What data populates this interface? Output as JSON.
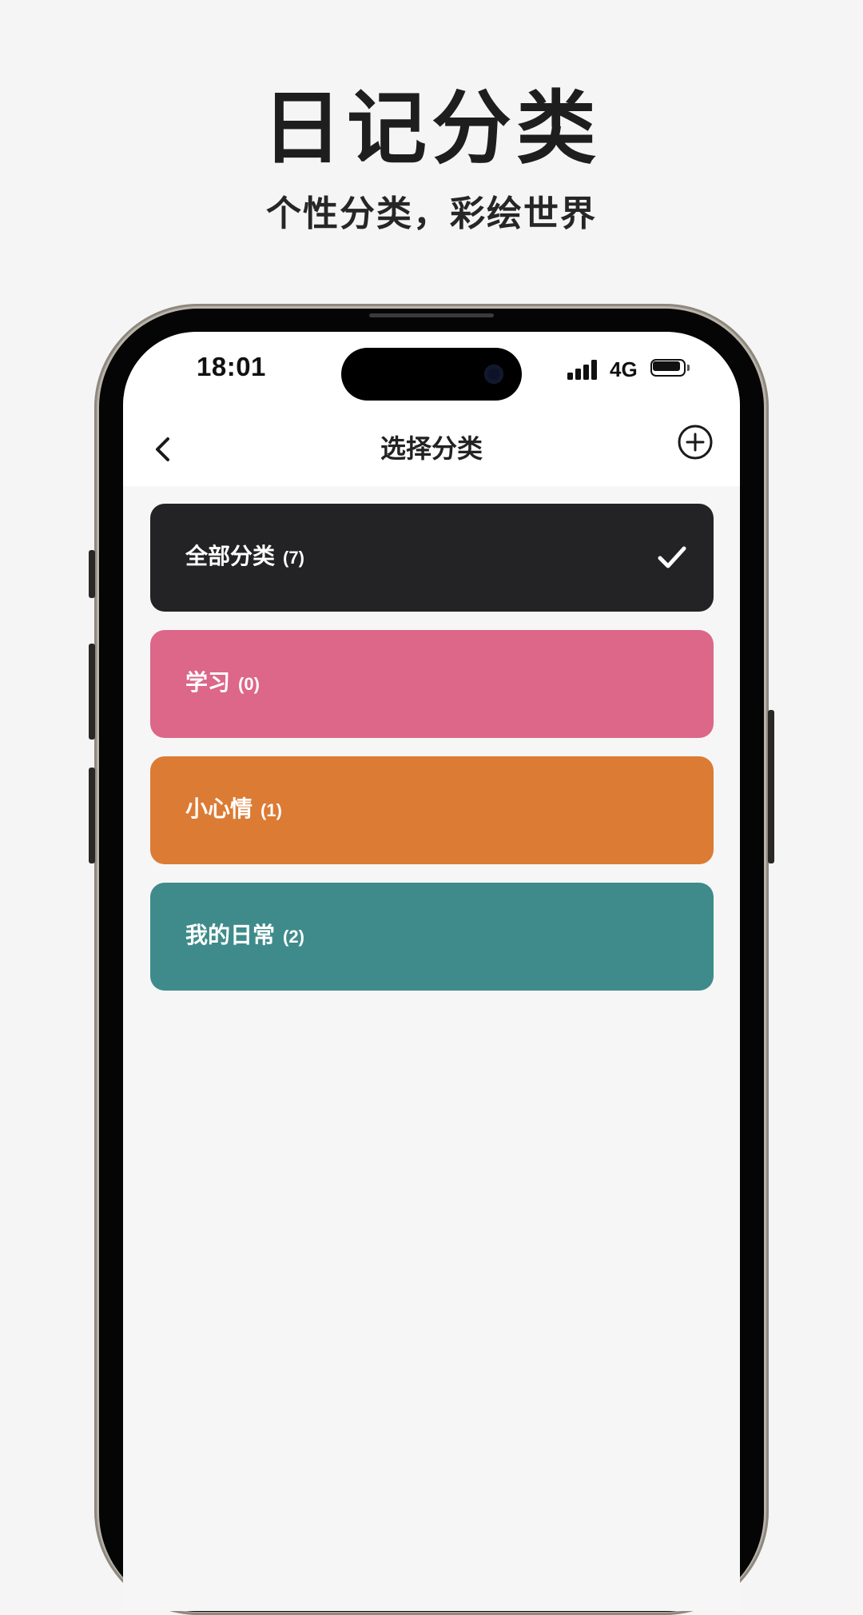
{
  "promo": {
    "title": "日记分类",
    "subtitle": "个性分类，彩绘世界"
  },
  "status_bar": {
    "time": "18:01",
    "network": "4G",
    "icons": [
      "signal-icon",
      "battery-icon"
    ]
  },
  "nav": {
    "title": "选择分类",
    "back_icon": "chevron-left-icon",
    "add_icon": "plus-circle-icon"
  },
  "categories": [
    {
      "name": "全部分类",
      "count": "(7)",
      "color": "#232325",
      "selected": true
    },
    {
      "name": "学习",
      "count": "(0)",
      "color": "#dc6788",
      "selected": false
    },
    {
      "name": "小心情",
      "count": "(1)",
      "color": "#dc7b34",
      "selected": false
    },
    {
      "name": "我的日常",
      "count": "(2)",
      "color": "#3f8b8b",
      "selected": false
    }
  ],
  "colors": {
    "background": "#f5f5f5",
    "screen_background": "#f6f6f6",
    "header_background": "#ffffff"
  }
}
